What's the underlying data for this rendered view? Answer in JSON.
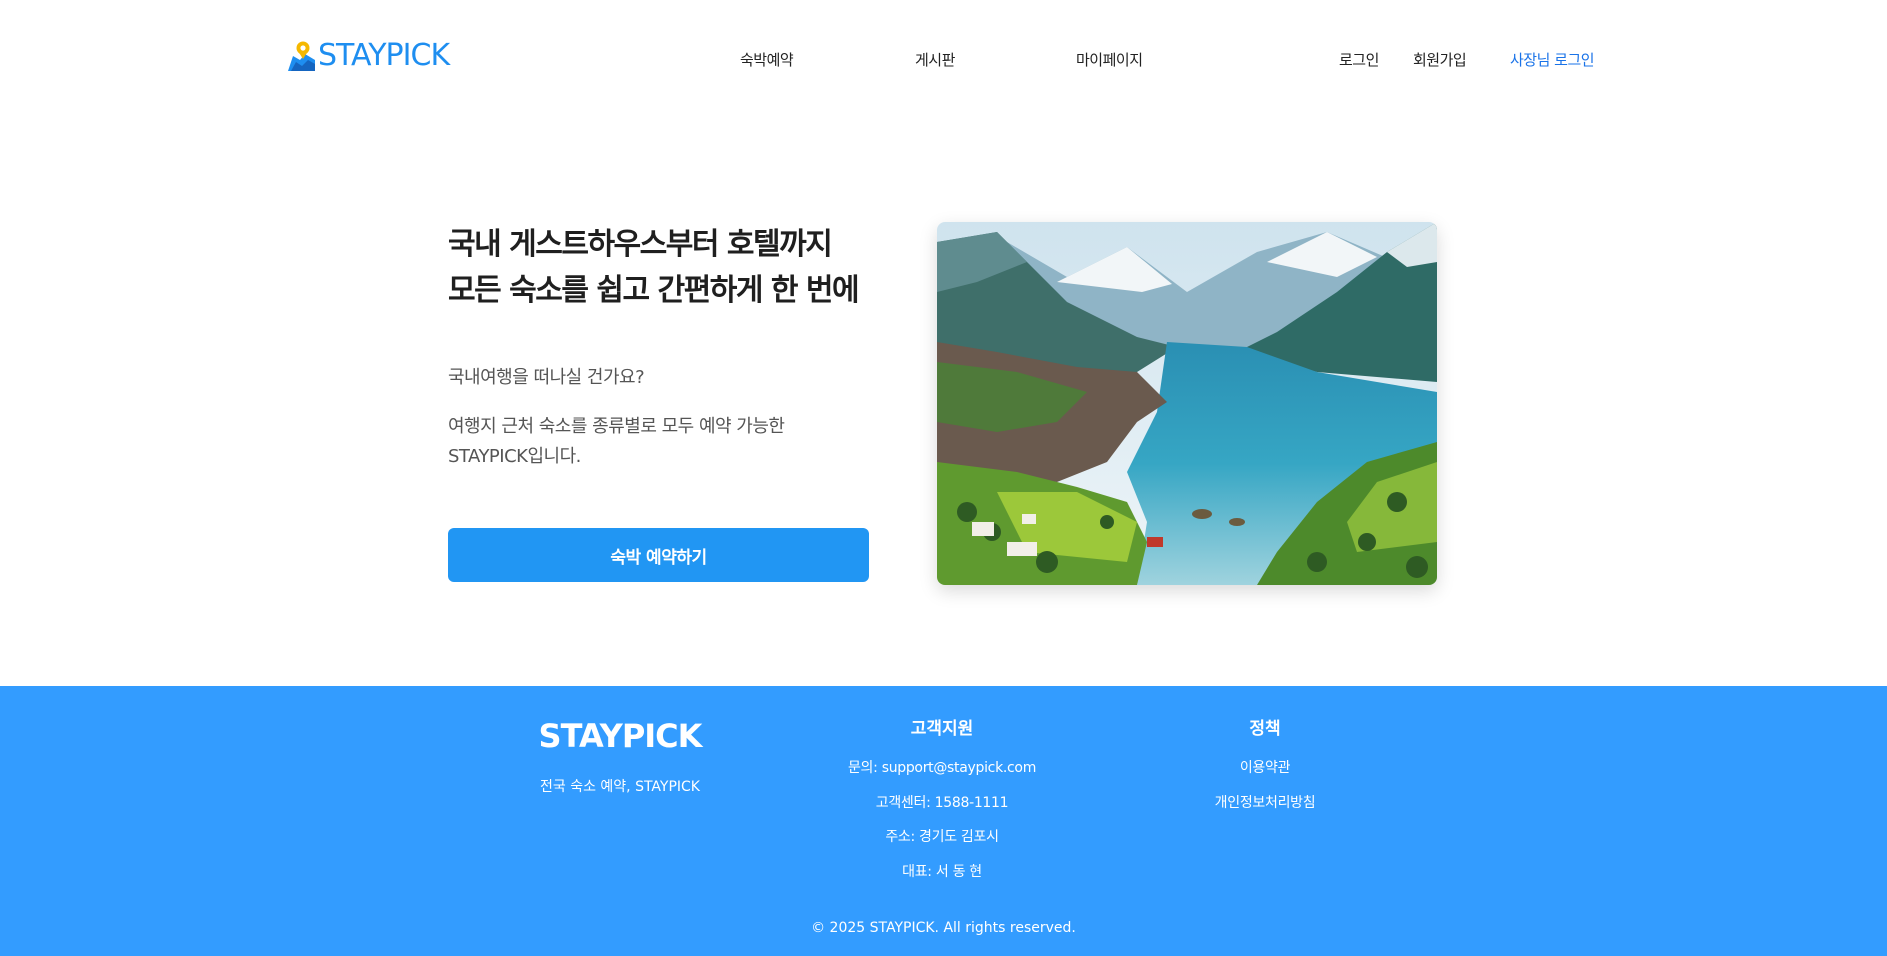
{
  "header": {
    "logo_text": "STAYPICK",
    "nav": [
      "숙박예약",
      "게시판",
      "마이페이지"
    ],
    "login": "로그인",
    "signup": "회원가입",
    "owner_login": "사장님 로그인"
  },
  "hero": {
    "title_line1": "국내 게스트하우스부터 호텔까지",
    "title_line2": "모든 숙소를 쉽고 간편하게 한 번에",
    "subtitle": "국내여행을 떠나실 건가요?",
    "description": "여행지 근처 숙소를 종류별로 모두 예약 가능한 STAYPICK입니다.",
    "cta_label": "숙박 예약하기"
  },
  "footer": {
    "brand": "STAYPICK",
    "tagline": "전국 숙소 예약, STAYPICK",
    "support_title": "고객지원",
    "support_lines": [
      "문의: support@staypick.com",
      "고객센터: 1588-1111",
      "주소: 경기도 김포시",
      "대표: 서 동 현"
    ],
    "policy_title": "정책",
    "policy_links": [
      "이용약관",
      "개인정보처리방침"
    ],
    "copyright": "© 2025 STAYPICK. All rights reserved."
  },
  "colors": {
    "brand_blue": "#1e8ef0",
    "cta_blue": "#2196f3",
    "footer_blue": "#339cff",
    "owner_link": "#1a73e8"
  },
  "icons": {
    "logo": "map-pin-icon"
  }
}
